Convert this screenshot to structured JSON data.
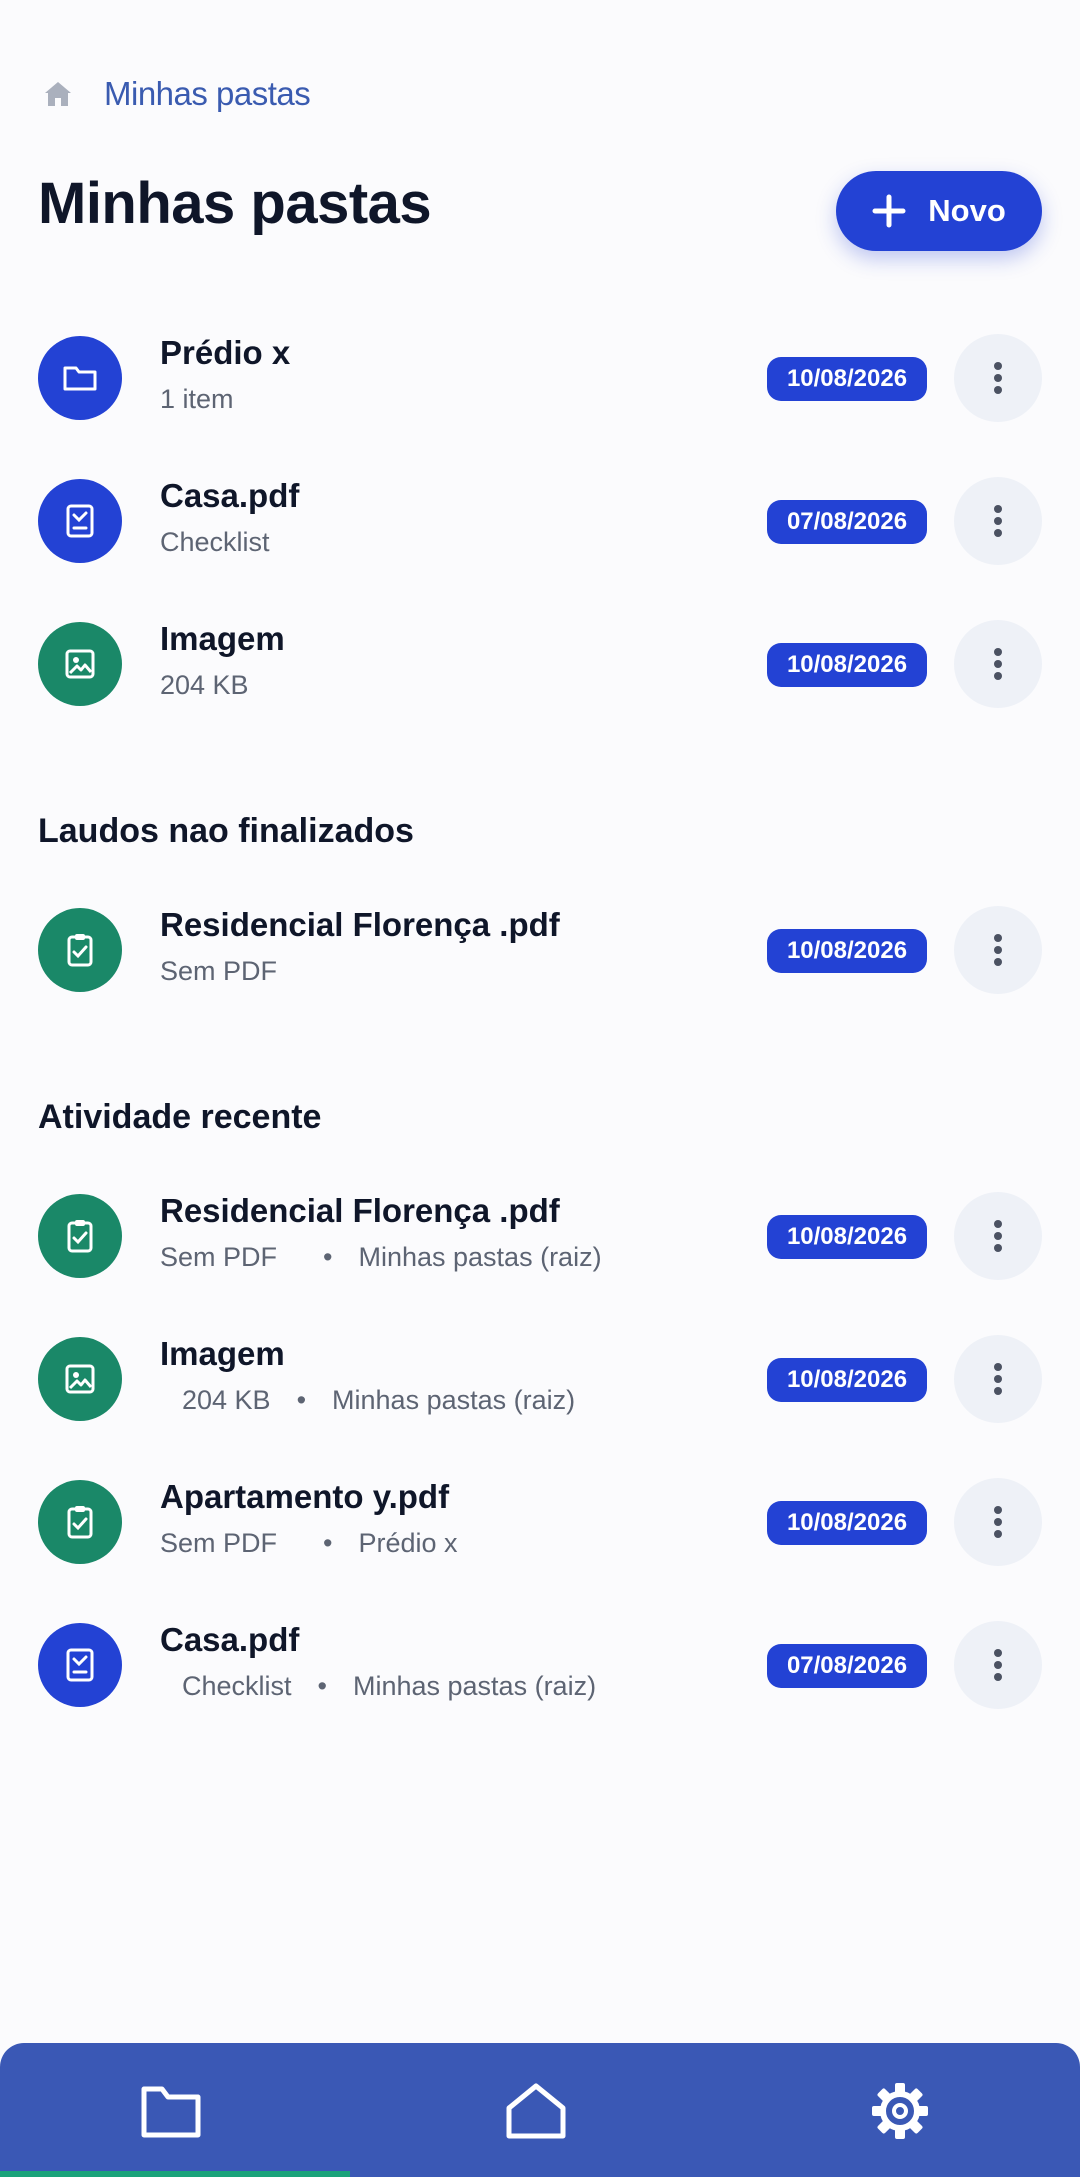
{
  "breadcrumb": {
    "home_icon": "home-icon",
    "current": "Minhas pastas"
  },
  "page": {
    "title": "Minhas pastas",
    "new_button_label": "Novo"
  },
  "colors": {
    "primary": "#2342d4",
    "green": "#1a8868",
    "nav": "#3a58b5",
    "badge": "#2342d4"
  },
  "items": [
    {
      "name": "Prédio x",
      "meta": "1 item",
      "date": "10/08/2026",
      "icon": "folder-icon"
    },
    {
      "name": "Casa.pdf",
      "meta": "Checklist",
      "date": "07/08/2026",
      "icon": "checklist-doc-icon"
    },
    {
      "name": "Imagem",
      "meta": "204 KB",
      "date": "10/08/2026",
      "icon": "image-icon"
    }
  ],
  "sections": {
    "pending_title": "Laudos nao finalizados",
    "recent_title": "Atividade recente"
  },
  "pending": [
    {
      "name": "Residencial Florença .pdf",
      "meta": "Sem PDF",
      "date": "10/08/2026",
      "icon": "clipboard-check-icon"
    }
  ],
  "recent": [
    {
      "name": "Residencial Florença .pdf",
      "meta": "Sem PDF",
      "location": "Minhas pastas (raiz)",
      "date": "10/08/2026",
      "icon": "clipboard-check-icon"
    },
    {
      "name": "Imagem",
      "meta": "204 KB",
      "location": "Minhas pastas (raiz)",
      "date": "10/08/2026",
      "icon": "image-icon"
    },
    {
      "name": "Apartamento y.pdf",
      "meta": "Sem PDF",
      "location": "Prédio x",
      "date": "10/08/2026",
      "icon": "clipboard-check-icon"
    },
    {
      "name": "Casa.pdf",
      "meta": "Checklist",
      "location": "Minhas pastas (raiz)",
      "date": "07/08/2026",
      "icon": "checklist-doc-icon"
    }
  ],
  "separator": "•",
  "bottom_nav": [
    {
      "icon": "folder-nav-icon"
    },
    {
      "icon": "home-nav-icon"
    },
    {
      "icon": "settings-gear-icon"
    }
  ]
}
